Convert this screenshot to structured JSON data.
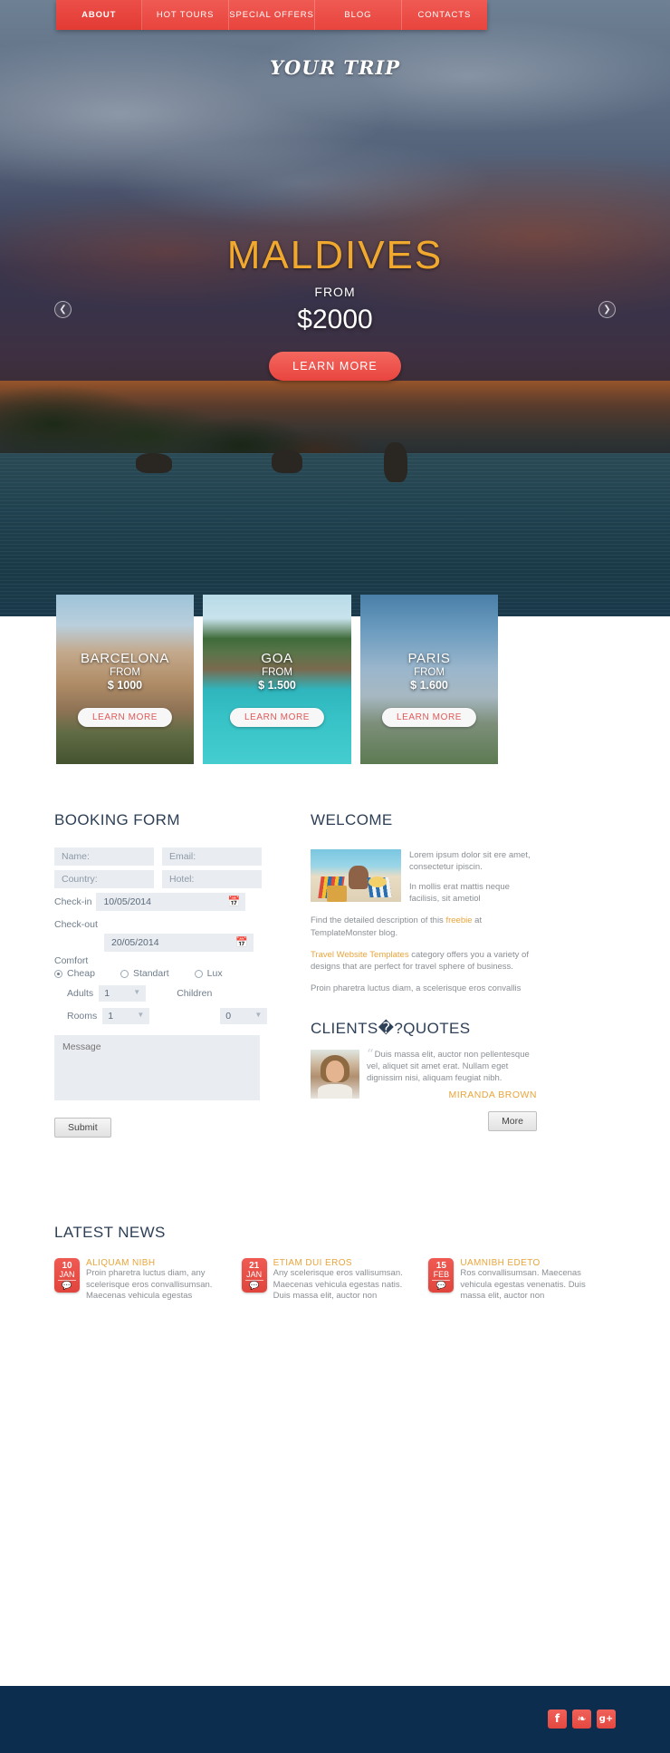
{
  "nav": {
    "items": [
      {
        "label": "ABOUT",
        "active": true
      },
      {
        "label": "HOT TOURS",
        "active": false
      },
      {
        "label": "SPECIAL OFFERS",
        "active": false
      },
      {
        "label": "BLOG",
        "active": false
      },
      {
        "label": "CONTACTS",
        "active": false
      }
    ]
  },
  "logo": {
    "text": "YOUR TRIP",
    "icon": "airplane-icon"
  },
  "hero": {
    "title": "MALDIVES",
    "from_label": "FROM",
    "price": "$2000",
    "button": "LEARN MORE",
    "prev_icon": "chevron-left-icon",
    "next_icon": "chevron-right-icon"
  },
  "cards": [
    {
      "name": "BARCELONA",
      "from_label": "FROM",
      "price": "$ 1000",
      "button": "LEARN MORE"
    },
    {
      "name": "GOA",
      "from_label": "FROM",
      "price": "$ 1.500",
      "button": "LEARN MORE"
    },
    {
      "name": "PARIS",
      "from_label": "FROM",
      "price": "$ 1.600",
      "button": "LEARN MORE"
    }
  ],
  "booking": {
    "title": "BOOKING FORM",
    "name_placeholder": "Name:",
    "email_placeholder": "Email:",
    "country_placeholder": "Country:",
    "hotel_placeholder": "Hotel:",
    "checkin_label": "Check-in",
    "checkin_value": "10/05/2014",
    "checkout_label": "Check-out",
    "checkout_value": "20/05/2014",
    "calendar_icon": "calendar-icon",
    "comfort_label": "Comfort",
    "comfort_options": [
      {
        "label": "Cheap",
        "checked": true
      },
      {
        "label": "Standart",
        "checked": false
      },
      {
        "label": "Lux",
        "checked": false
      }
    ],
    "adults_label": "Adults",
    "adults_value": "1",
    "children_label": "Children",
    "children_value": "0",
    "rooms_label": "Rooms",
    "rooms_value": "1",
    "message_placeholder": "Message",
    "submit_label": "Submit"
  },
  "welcome": {
    "title": "WELCOME",
    "image_alt": "couple-on-beach-image",
    "intro": "Lorem ipsum dolor sit ere amet, consectetur ipiscin.",
    "intro2": "In mollis erat mattis neque facilisis, sit ametiol",
    "para_find_1": "Find the detailed description of this ",
    "para_find_link": "freebie",
    "para_find_2": " at TemplateMonster blog.",
    "para_cat_link": "Travel Website Templates",
    "para_cat_rest": " category offers you a variety of designs that are perfect for travel sphere of business.",
    "para_last": "Proin pharetra luctus diam, a scelerisque eros convallis"
  },
  "quotes": {
    "title": "CLIENTS�?QUOTES",
    "avatar_alt": "client-photo",
    "quote_mark": "“",
    "text": "Duis massa elit, auctor non pellentesque vel, aliquet sit amet erat. Nullam eget dignissim nisi, aliquam feugiat nibh.",
    "author": "MIRANDA BROWN",
    "more_label": "More"
  },
  "news": {
    "title": "LATEST NEWS",
    "items": [
      {
        "day": "10",
        "month": "JAN",
        "comment_icon": "comment-bubble-icon",
        "title": "ALIQUAM NIBH",
        "text": "Proin pharetra luctus diam, any scelerisque eros convallisumsan. Maecenas vehicula egestas"
      },
      {
        "day": "21",
        "month": "JAN",
        "comment_icon": "comment-bubble-icon",
        "title": "ETIAM DUI EROS",
        "text": "Any scelerisque eros vallisumsan. Maecenas vehicula egestas natis. Duis massa elit, auctor non"
      },
      {
        "day": "15",
        "month": "FEB",
        "comment_icon": "comment-bubble-icon",
        "title": "UAMNIBH EDETO",
        "text": "Ros convallisumsan. Maecenas vehicula egestas venenatis. Duis massa elit, auctor non"
      }
    ]
  },
  "footer": {
    "social": [
      {
        "name": "facebook-icon",
        "glyph": "f"
      },
      {
        "name": "twitter-icon",
        "glyph": "❧"
      },
      {
        "name": "google-plus-icon",
        "glyph": "g+"
      }
    ]
  },
  "colors": {
    "accent_red": "#e8453d",
    "accent_gold": "#e9a53c",
    "hero_title": "#f0a92e",
    "footer_navy": "#0d2d4e",
    "heading_navy": "#2e4057"
  }
}
